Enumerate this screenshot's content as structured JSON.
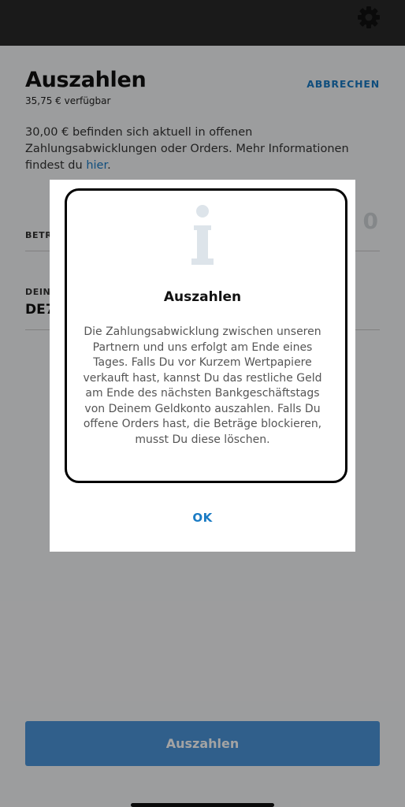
{
  "header": {
    "settings_icon": "gear-icon"
  },
  "screen": {
    "title": "Auszahlen",
    "available": "35,75 € verfügbar",
    "cancel_label": "ABBRECHEN",
    "info_text": "30,00 € befinden sich aktuell in offenen Zahlungsabwicklungen oder Orders. Mehr Informationen findest du ",
    "info_link": "hier",
    "info_end": ".",
    "amount_label": "BETR",
    "amount_placeholder": "0",
    "iban_label": "DEIN",
    "iban_value": "DE7",
    "submit_label": "Auszahlen"
  },
  "dialog": {
    "icon": "info-icon",
    "title": "Auszahlen",
    "body": "Die Zahlungsabwicklung zwischen unseren Partnern und uns erfolgt am Ende eines Tages. Falls Du vor Kurzem Wertpapiere verkauft hast, kannst Du das restliche Geld am Ende des nächsten Bankgeschäftstags von Deinem Geldkonto auszahlen. Falls Du offene Orders hast, die Beträge blockieren, musst Du diese löschen.",
    "ok_label": "OK"
  },
  "colors": {
    "accent": "#1a7bc4",
    "primary_button": "#4b95d9",
    "highlight_border": "#000000"
  }
}
